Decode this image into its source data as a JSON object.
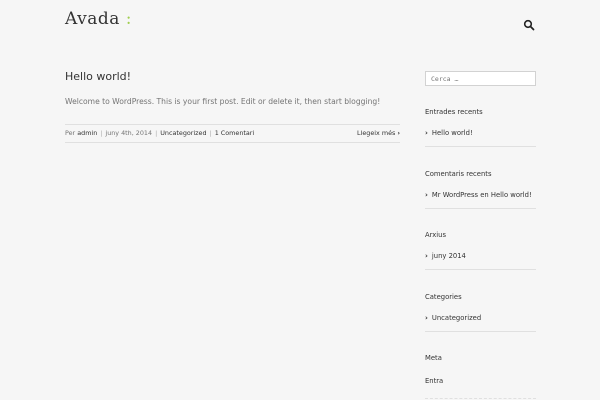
{
  "header": {
    "logo_text": "Avada",
    "logo_accent": ":",
    "search_icon": "search-icon"
  },
  "post": {
    "title": "Hello world!",
    "excerpt": "Welcome to WordPress. This is your first post. Edit or delete it, then start blogging!",
    "meta_by": "Per",
    "meta_author": "admin",
    "meta_date": "juny 4th, 2014",
    "meta_category": "Uncategorized",
    "meta_comments": "1 Comentari",
    "read_more": "Llegeix més"
  },
  "sidebar": {
    "search_placeholder": "Cerca …",
    "recent_title": "Entrades recents",
    "recent_items": [
      "Hello world!"
    ],
    "comments_title": "Comentaris recents",
    "comments_items": [
      "Mr WordPress en Hello world!"
    ],
    "archive_title": "Arxius",
    "archive_items": [
      "juny 2014"
    ],
    "categories_title": "Categories",
    "categories_items": [
      "Uncategorized"
    ],
    "meta_title": "Meta",
    "meta_items": [
      "Entra"
    ]
  },
  "colors": {
    "accent": "#a0ce4e",
    "background": "#f6f6f6",
    "text": "#333333",
    "muted_text": "#747474",
    "divider": "#e0e0e0"
  }
}
